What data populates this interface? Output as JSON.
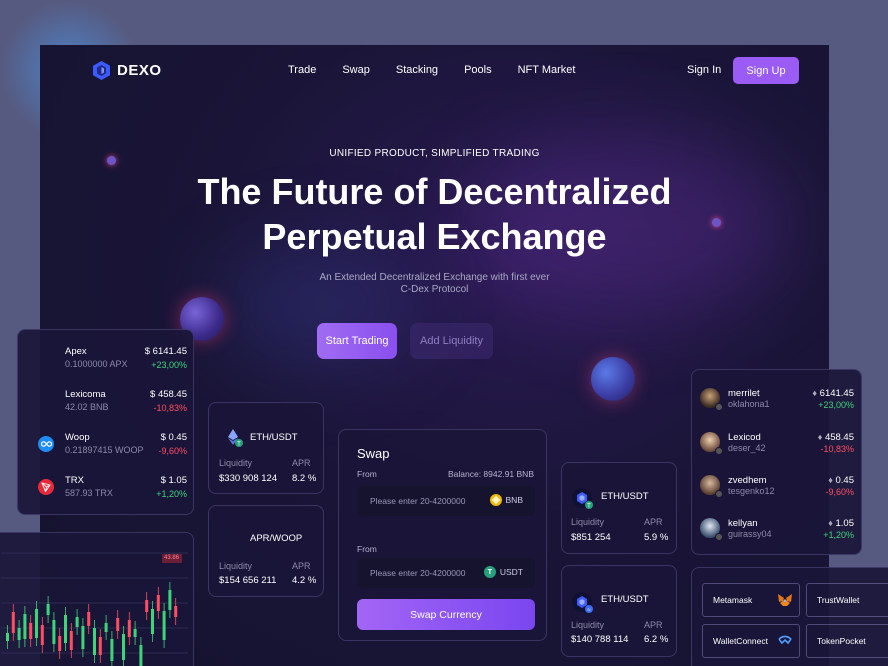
{
  "nav": {
    "brand": "DEXO",
    "links": [
      "Trade",
      "Swap",
      "Stacking",
      "Pools",
      "NFT Market"
    ],
    "sign_in": "Sign In",
    "sign_up": "Sign Up"
  },
  "hero": {
    "tagline": "UNIFIED PRODUCT, SIMPLIFIED TRADING",
    "headline_line1": "The Future of Decentralized",
    "headline_line2": "Perpetual Exchange",
    "sub_line1": "An Extended Decentralized Exchange with first ever",
    "sub_line2": "C-Dex Protocol",
    "start_trading": "Start Trading",
    "add_liquidity": "Add Liquidity"
  },
  "token_list": [
    {
      "name": "Apex",
      "amount": "0.1000000 APX",
      "price": "$ 6141.45",
      "change": "+23,00%",
      "direction": "up",
      "icon": "apex-icon"
    },
    {
      "name": "Lexicoma",
      "amount": "42.02 BNB",
      "price": "$ 458.45",
      "change": "-10,83%",
      "direction": "down",
      "icon": "lexicoma-icon"
    },
    {
      "name": "Woop",
      "amount": "0.21897415 WOOP",
      "price": "$ 0.45",
      "change": "-9,60%",
      "direction": "down",
      "icon": "woop-icon"
    },
    {
      "name": "TRX",
      "amount": "587.93 TRX",
      "price": "$ 1.05",
      "change": "+1,20%",
      "direction": "up",
      "icon": "tron-icon"
    }
  ],
  "mini_chart": {
    "price_tag": "43.86"
  },
  "pair_cards": [
    {
      "pair": "ETH/USDT",
      "liquidity_label": "Liquidity",
      "apr_label": "APR",
      "liquidity": "$330 908 124",
      "apr": "8.2 %",
      "icon": "eth-icon"
    },
    {
      "pair": "APR/WOOP",
      "liquidity_label": "Liquidity",
      "apr_label": "APR",
      "liquidity": "$154 656 211",
      "apr": "4.2 %",
      "icon": ""
    },
    {
      "pair": "ETH/USDT",
      "liquidity_label": "Liquidity",
      "apr_label": "APR",
      "liquidity": "$851 254",
      "apr": "5.9 %",
      "icon": "bnb-hex-icon"
    },
    {
      "pair": "ETH/USDT",
      "liquidity_label": "Liquidity",
      "apr_label": "APR",
      "liquidity": "$140 788 114",
      "apr": "6.2 %",
      "icon": "bnb-hex-icon"
    }
  ],
  "swap": {
    "title": "Swap",
    "from_label": "From",
    "balance": "Balance: 8942.91 BNB",
    "input1_placeholder": "Please enter 20-4200000",
    "input1_token": "BNB",
    "to_label": "From",
    "input2_placeholder": "Please enter 20-4200000",
    "input2_token": "USDT",
    "button": "Swap Currency"
  },
  "users": [
    {
      "name": "merrilet",
      "handle": "oklahona1",
      "price": "6141.45",
      "change": "+23,00%",
      "direction": "up"
    },
    {
      "name": "Lexicod",
      "handle": "deser_42",
      "price": "458.45",
      "change": "-10,83%",
      "direction": "down"
    },
    {
      "name": "zvedhem",
      "handle": "tesgenko12",
      "price": "0.45",
      "change": "-9,60%",
      "direction": "down"
    },
    {
      "name": "kellyan",
      "handle": "guirassy04",
      "price": "1.05",
      "change": "+1,20%",
      "direction": "up"
    }
  ],
  "wallets": [
    "Metamask",
    "TrustWallet",
    "WalletConnect",
    "TokenPocket"
  ],
  "colors": {
    "accent": "#9b5cf6",
    "positive": "#3ed47a",
    "negative": "#ff4d62",
    "background": "#15122e"
  }
}
